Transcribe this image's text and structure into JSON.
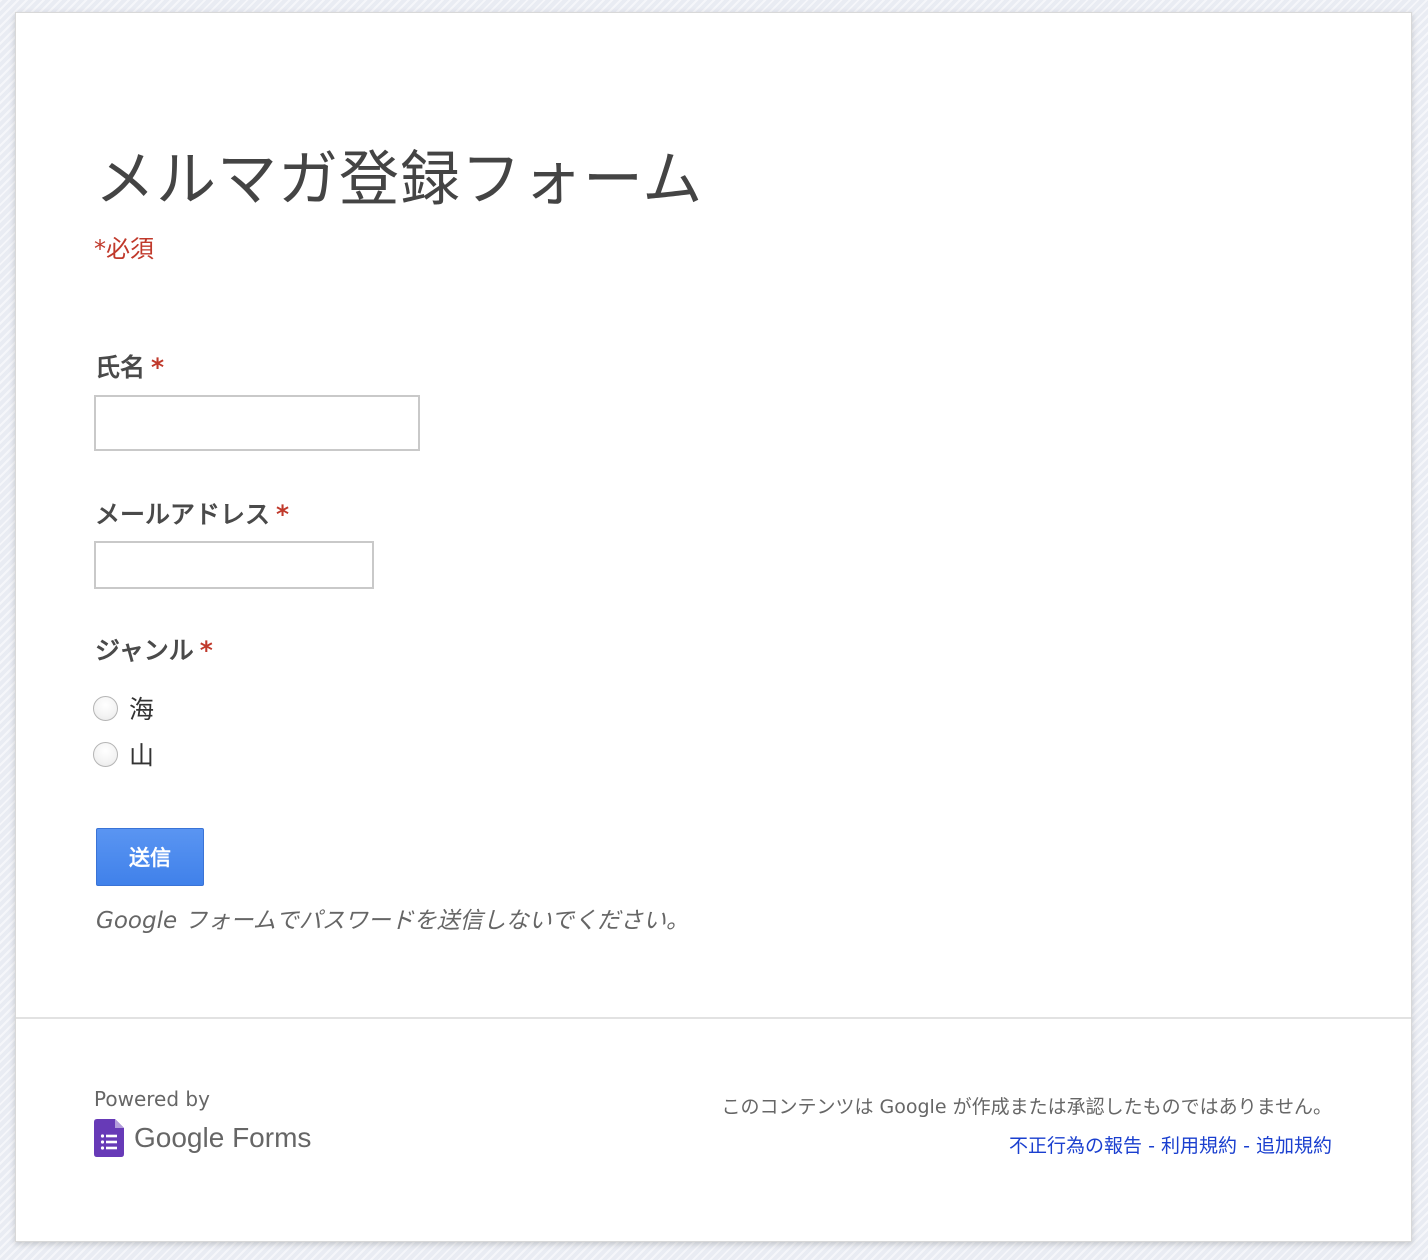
{
  "form": {
    "title": "メルマガ登録フォーム",
    "required_note": "*必須"
  },
  "questions": [
    {
      "label": "氏名",
      "required_mark": "*",
      "type": "text",
      "value": ""
    },
    {
      "label": "メールアドレス",
      "required_mark": "*",
      "type": "text",
      "value": ""
    },
    {
      "label": "ジャンル",
      "required_mark": "*",
      "type": "radio",
      "options": [
        {
          "label": "海",
          "selected": false
        },
        {
          "label": "山",
          "selected": false
        }
      ]
    }
  ],
  "submit": {
    "label": "送信",
    "color": "#4d8af0"
  },
  "password_warning": "Google フォームでパスワードを送信しないでください。",
  "footer": {
    "powered_by": "Powered by",
    "brand": "Google Forms",
    "brand_icon": "google-forms-icon",
    "brand_icon_color": "#673ab7",
    "disclaimer": "このコンテンツは Google が作成または承認したものではありません。",
    "links": [
      "不正行為の報告",
      "利用規約",
      "追加規約"
    ],
    "link_separator": "-",
    "link_color": "#1a3fcf"
  },
  "colors": {
    "required": "#c0392b",
    "background": "#e9ecf3",
    "card": "#ffffff"
  }
}
